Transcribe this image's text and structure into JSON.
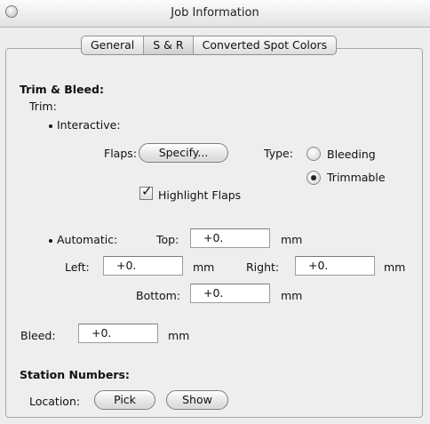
{
  "window": {
    "title": "Job Information"
  },
  "tabs": [
    "General",
    "S & R",
    "Converted Spot Colors"
  ],
  "selected_tab": "S & R",
  "trim_bleed": {
    "heading": "Trim & Bleed:",
    "trim_label": "Trim:",
    "interactive_label": "Interactive:",
    "flaps_label": "Flaps:",
    "specify_button": "Specify...",
    "type_label": "Type:",
    "type_options": [
      {
        "label": "Bleeding",
        "selected": false
      },
      {
        "label": "Trimmable",
        "selected": true
      }
    ],
    "highlight_flaps_label": "Highlight Flaps",
    "highlight_flaps_checked": true,
    "automatic_label": "Automatic:",
    "top_label": "Top:",
    "top_value": "+0.",
    "left_label": "Left:",
    "left_value": "+0.",
    "right_label": "Right:",
    "right_value": "+0.",
    "bottom_label": "Bottom:",
    "bottom_value": "+0.",
    "unit": "mm",
    "bleed_label": "Bleed:",
    "bleed_value": "+0."
  },
  "station_numbers": {
    "heading": "Station Numbers:",
    "location_label": "Location:",
    "pick_button": "Pick",
    "show_button": "Show"
  },
  "icons": {
    "close": "close-icon",
    "checkmark": "checkmark-icon"
  }
}
